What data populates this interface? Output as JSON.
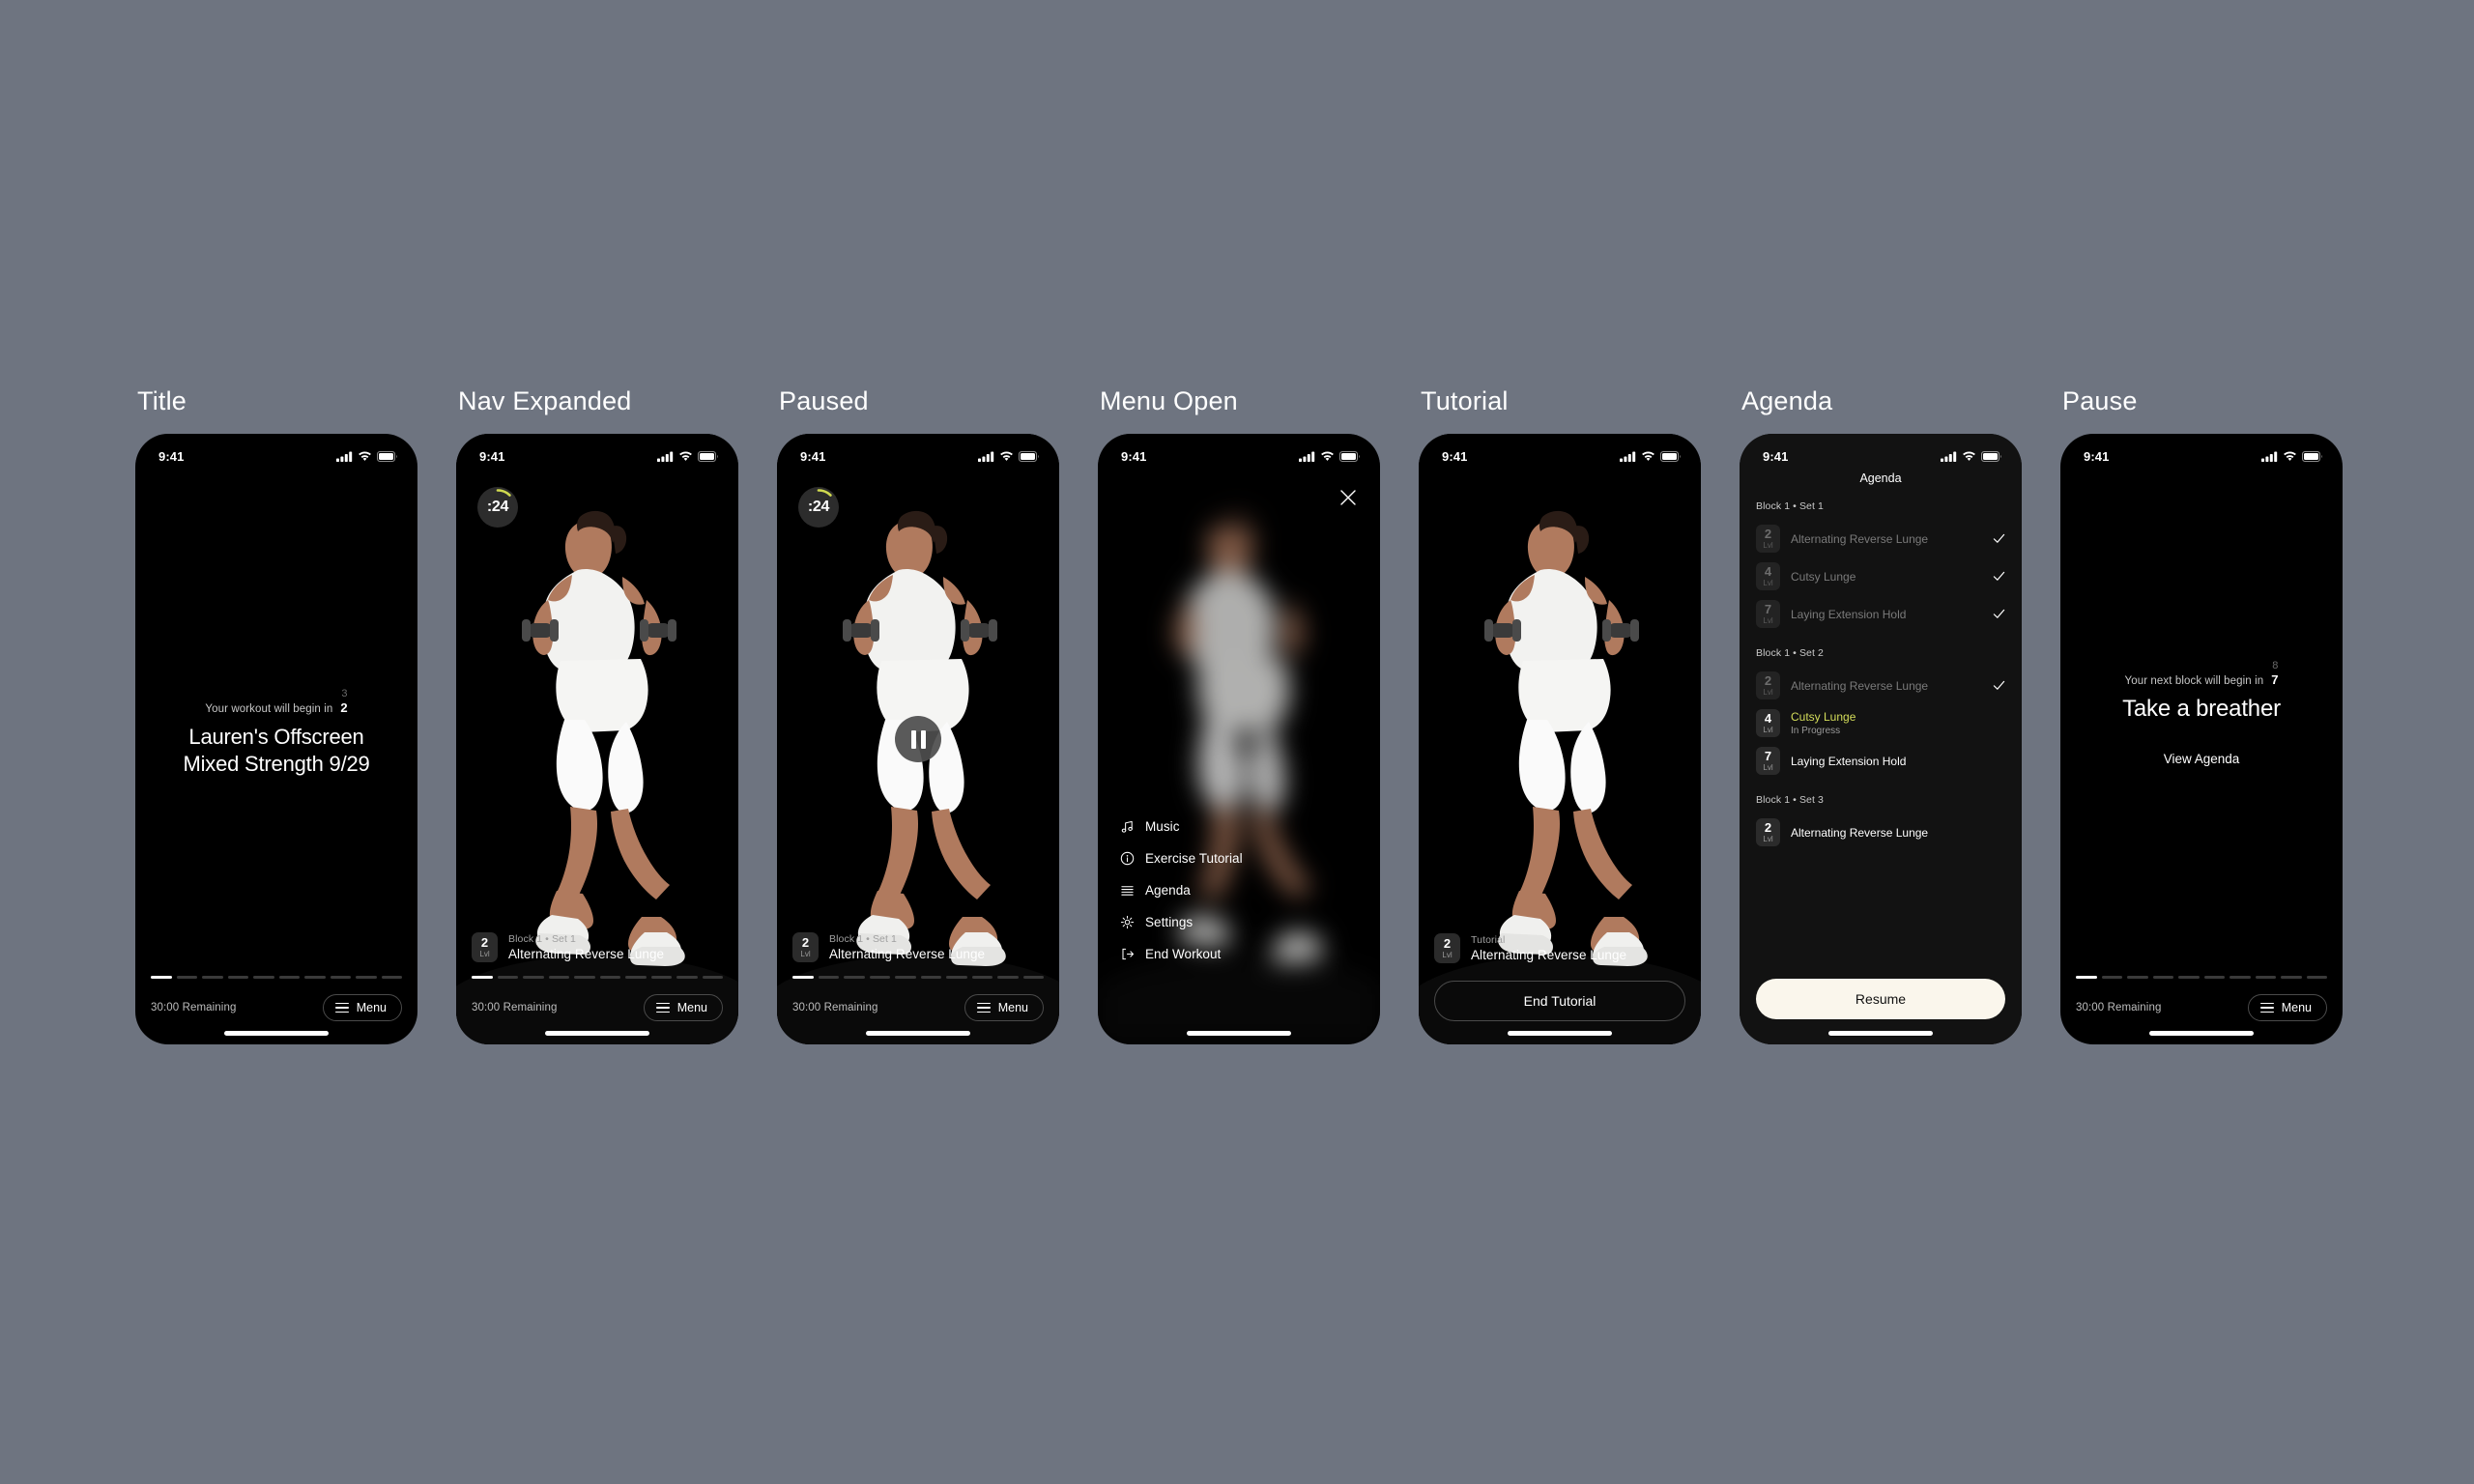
{
  "status_bar": {
    "time": "9:41"
  },
  "common": {
    "remaining": "30:00 Remaining",
    "menu_label": "Menu",
    "lvl_suffix": "Lvl",
    "progress_total": 10,
    "progress_done": 1
  },
  "accent": {
    "lime": "#d4dd5a",
    "cream": "#faf6ec",
    "panel": "#121212"
  },
  "frames": [
    {
      "label": "Title",
      "countdown_prefix": "Your workout will begin in",
      "countdown_value": "2",
      "countdown_ghost": "3",
      "title_line1": "Lauren's Offscreen",
      "title_line2": "Mixed Strength 9/29"
    },
    {
      "label": "Nav Expanded",
      "timer": ":24",
      "block_set": "Block 1 • Set 1",
      "exercise": "Alternating Reverse Lunge",
      "level": "2"
    },
    {
      "label": "Paused",
      "timer": ":24",
      "block_set": "Block 1 • Set 1",
      "exercise": "Alternating Reverse Lunge",
      "level": "2"
    },
    {
      "label": "Menu Open",
      "menu_items": [
        {
          "icon": "music-icon",
          "label": "Music"
        },
        {
          "icon": "info-icon",
          "label": "Exercise Tutorial"
        },
        {
          "icon": "list-icon",
          "label": "Agenda"
        },
        {
          "icon": "gear-icon",
          "label": "Settings"
        },
        {
          "icon": "exit-icon",
          "label": "End Workout"
        }
      ]
    },
    {
      "label": "Tutorial",
      "sub": "Tutorial",
      "exercise": "Alternating Reverse Lunge",
      "level": "2",
      "end_tutorial_label": "End Tutorial"
    },
    {
      "label": "Agenda",
      "header": "Agenda",
      "resume_label": "Resume",
      "groups": [
        {
          "label": "Block 1 • Set 1",
          "rows": [
            {
              "level": "2",
              "name": "Alternating Reverse Lunge",
              "state": "done"
            },
            {
              "level": "4",
              "name": "Cutsy Lunge",
              "state": "done"
            },
            {
              "level": "7",
              "name": "Laying Extension Hold",
              "state": "done"
            }
          ]
        },
        {
          "label": "Block 1 • Set 2",
          "rows": [
            {
              "level": "2",
              "name": "Alternating Reverse Lunge",
              "state": "done"
            },
            {
              "level": "4",
              "name": "Cutsy Lunge",
              "state": "active",
              "status": "In Progress"
            },
            {
              "level": "7",
              "name": "Laying Extension Hold",
              "state": "upcoming"
            }
          ]
        },
        {
          "label": "Block 1 • Set 3",
          "rows": [
            {
              "level": "2",
              "name": "Alternating Reverse Lunge",
              "state": "upcoming"
            }
          ]
        }
      ]
    },
    {
      "label": "Pause",
      "countdown_prefix": "Your next block will begin in",
      "countdown_value": "7",
      "countdown_ghost": "8",
      "breather_title": "Take a breather",
      "view_agenda_label": "View Agenda"
    }
  ]
}
